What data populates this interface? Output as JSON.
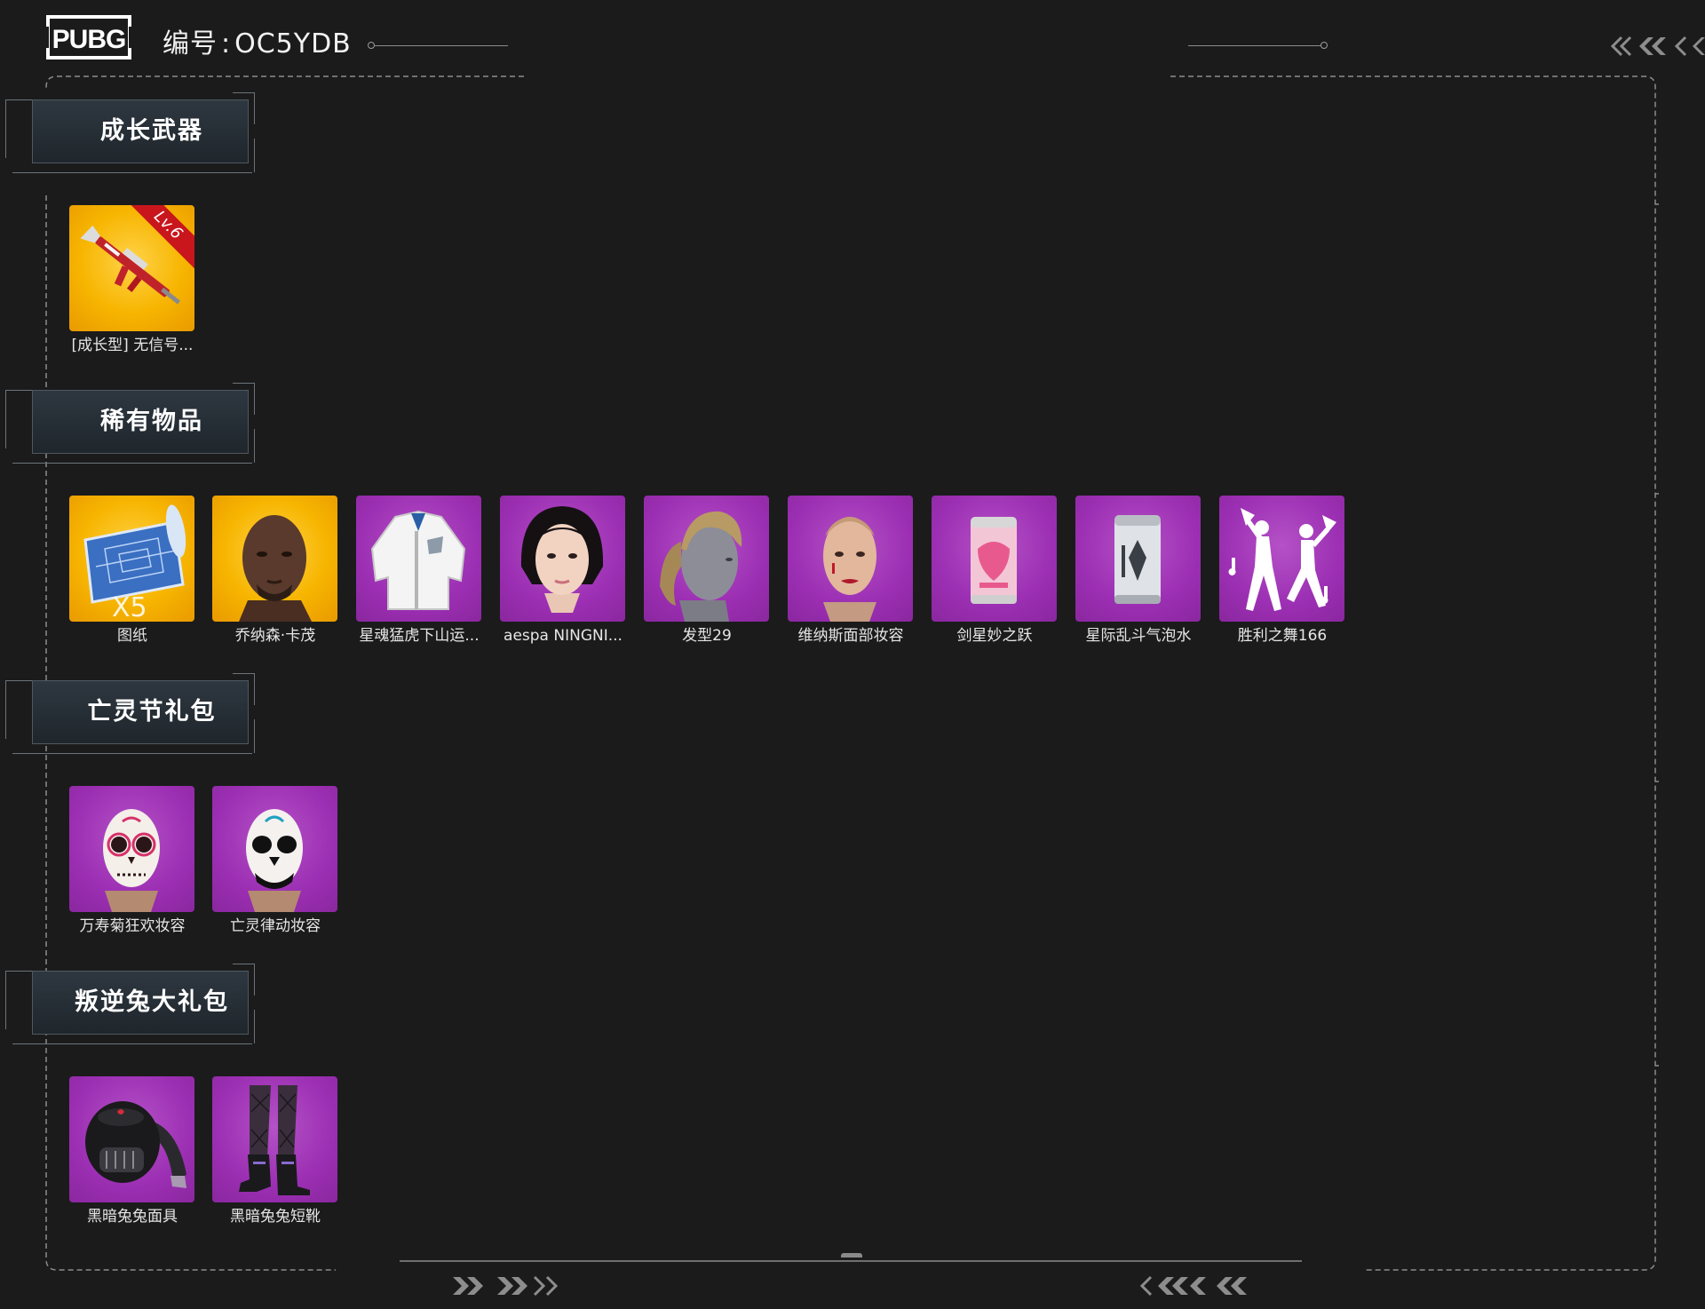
{
  "header": {
    "logo_text": "PUBG",
    "id_prefix": "编号",
    "id_separator": ":",
    "id_value": "OC5YDB"
  },
  "sections": [
    {
      "title": "成长武器",
      "items": [
        {
          "label": "[成长型] 无信号...",
          "icon": "rifle-icon",
          "rarity": "gold",
          "badge": "Lv.6"
        }
      ]
    },
    {
      "title": "稀有物品",
      "items": [
        {
          "label": "图纸",
          "icon": "blueprint-icon",
          "rarity": "gold",
          "badge": "X5"
        },
        {
          "label": "乔纳森·卡茂",
          "icon": "character-face-icon",
          "rarity": "gold"
        },
        {
          "label": "星魂猛虎下山运...",
          "icon": "jacket-icon",
          "rarity": "purple"
        },
        {
          "label": "aespa NINGNI...",
          "icon": "female-face-icon",
          "rarity": "purple"
        },
        {
          "label": "发型29",
          "icon": "hairstyle-icon",
          "rarity": "purple"
        },
        {
          "label": "维纳斯面部妆容",
          "icon": "face-makeup-icon",
          "rarity": "purple"
        },
        {
          "label": "剑星妙之跃",
          "icon": "pink-can-icon",
          "rarity": "purple"
        },
        {
          "label": "星际乱斗气泡水",
          "icon": "silver-can-icon",
          "rarity": "purple"
        },
        {
          "label": "胜利之舞166",
          "icon": "dance-emote-icon",
          "rarity": "purple"
        }
      ]
    },
    {
      "title": "亡灵节礼包",
      "items": [
        {
          "label": "万寿菊狂欢妆容",
          "icon": "sugar-skull-makeup-icon",
          "rarity": "purple"
        },
        {
          "label": "亡灵律动妆容",
          "icon": "skull-makeup-icon",
          "rarity": "purple"
        }
      ]
    },
    {
      "title": "叛逆兔大礼包",
      "items": [
        {
          "label": "黑暗兔兔面具",
          "icon": "rabbit-mask-icon",
          "rarity": "purple"
        },
        {
          "label": "黑暗兔兔短靴",
          "icon": "boots-icon",
          "rarity": "purple"
        }
      ]
    }
  ],
  "colors": {
    "background": "#1b1b1c",
    "gold_tile": "#f7b500",
    "purple_tile": "#9c2fb3",
    "badge_red": "#c8161c"
  }
}
